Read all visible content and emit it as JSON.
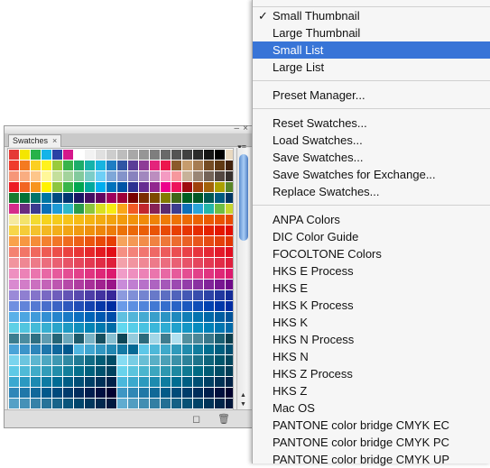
{
  "panel": {
    "tab_label": "Swatches",
    "tab_close": "×",
    "titlebar_minimize": "–",
    "titlebar_close": "×",
    "menu_glyph": "▾≡",
    "scroll_up": "▲",
    "scroll_down": "▼",
    "footer_new_icon": "◻",
    "footer_trash_icon": "🗑"
  },
  "menu": {
    "check_glyph": "✓",
    "items": [
      {
        "label": "",
        "checked": false
      },
      {
        "label": "Small Thumbnail",
        "checked": true
      },
      {
        "label": "Large Thumbnail",
        "checked": false
      },
      {
        "label": "Small List",
        "checked": false,
        "selected": true
      },
      {
        "label": "Large List",
        "checked": false
      },
      {
        "label": "Preset Manager...",
        "checked": false
      },
      {
        "label": "Reset Swatches...",
        "checked": false
      },
      {
        "label": "Load Swatches...",
        "checked": false
      },
      {
        "label": "Save Swatches...",
        "checked": false
      },
      {
        "label": "Save Swatches for Exchange...",
        "checked": false
      },
      {
        "label": "Replace Swatches...",
        "checked": false
      },
      {
        "label": "ANPA Colors",
        "checked": false
      },
      {
        "label": "DIC Color Guide",
        "checked": false
      },
      {
        "label": "FOCOLTONE Colors",
        "checked": false
      },
      {
        "label": "HKS E Process",
        "checked": false
      },
      {
        "label": "HKS E",
        "checked": false
      },
      {
        "label": "HKS K Process",
        "checked": false
      },
      {
        "label": "HKS K",
        "checked": false
      },
      {
        "label": "HKS N Process",
        "checked": false
      },
      {
        "label": "HKS N",
        "checked": false
      },
      {
        "label": "HKS Z Process",
        "checked": false
      },
      {
        "label": "HKS Z",
        "checked": false
      },
      {
        "label": "Mac OS",
        "checked": false
      },
      {
        "label": "PANTONE color bridge CMYK EC",
        "checked": false
      },
      {
        "label": "PANTONE color bridge CMYK PC",
        "checked": false
      },
      {
        "label": "PANTONE color bridge CMYK UP",
        "checked": false
      }
    ]
  },
  "swatch_rows": [
    [
      "#e53935",
      "#f4e600",
      "#27b24a",
      "#14b4e8",
      "#2a41a5",
      "#d5178b",
      "#ffffff",
      "#f2f2f2",
      "#e0e0e0",
      "#cdcdcd",
      "#bdbdbd",
      "#a8a8a8",
      "#969696",
      "#7e7e7e",
      "#696969",
      "#545454",
      "#414141",
      "#2b2b2b",
      "#151515",
      "#000000",
      "#e8d8c0"
    ],
    [
      "#ef3b2c",
      "#f47a21",
      "#fbcf22",
      "#fff21d",
      "#9acb3b",
      "#39b44a",
      "#1cad6a",
      "#16b3ab",
      "#17b4e0",
      "#1e7dc3",
      "#2f55a4",
      "#5a3d98",
      "#8e3c97",
      "#e4247b",
      "#ec174d",
      "#8b5a2b",
      "#c69c6d",
      "#a67c52",
      "#754c24",
      "#603913",
      "#41220d"
    ],
    [
      "#f69679",
      "#f9ad81",
      "#fdc68a",
      "#fff799",
      "#c4df9b",
      "#a3d39c",
      "#82ca9d",
      "#7bcdc8",
      "#6ecff6",
      "#7ea7d8",
      "#8493ca",
      "#8882be",
      "#a187be",
      "#bc8dbf",
      "#f49ac2",
      "#f6989d",
      "#c7b299",
      "#998675",
      "#736357",
      "#534741",
      "#37302d"
    ],
    [
      "#ed1c24",
      "#f26522",
      "#f7941d",
      "#fff200",
      "#8dc63f",
      "#39b54a",
      "#00a651",
      "#00a99d",
      "#00aeef",
      "#0072bc",
      "#0054a6",
      "#2e3192",
      "#662d91",
      "#92278f",
      "#ec008c",
      "#ed145b",
      "#9e0b0f",
      "#a0410d",
      "#a36209",
      "#aba000",
      "#598527"
    ],
    [
      "#197b30",
      "#007236",
      "#00746b",
      "#0076a3",
      "#004a80",
      "#003471",
      "#1b1464",
      "#440e62",
      "#630460",
      "#9e005d",
      "#9e0039",
      "#790000",
      "#7b2e00",
      "#7d4900",
      "#827b00",
      "#406618",
      "#005e20",
      "#005826",
      "#005952",
      "#005b7f",
      "#003663"
    ],
    [
      "#d62a8a",
      "#6a2c7e",
      "#3b3a8f",
      "#0b6fb6",
      "#1e9ad6",
      "#2fb7c9",
      "#2a9c4b",
      "#8cc63e",
      "#d9e021",
      "#f7ec13",
      "#f9a61a",
      "#f15a24",
      "#c1272d",
      "#862255",
      "#5b2c6f",
      "#3c3d8f",
      "#0f6fb7",
      "#2aa4d8",
      "#25b6a8",
      "#6fbe44",
      "#c6d52e"
    ],
    [
      "#f5e9a0",
      "#f3e36b",
      "#f3db31",
      "#f6d31d",
      "#f4cb1b",
      "#f6c31a",
      "#f5bb15",
      "#f4b312",
      "#f3ab10",
      "#f2a30d",
      "#f29b0c",
      "#f1930a",
      "#f08b09",
      "#ef8307",
      "#ee7b06",
      "#ed7305",
      "#ec6b04",
      "#eb6303",
      "#ea5b02",
      "#e95301",
      "#e84b00"
    ],
    [
      "#f7d64a",
      "#f5cc38",
      "#f4c22c",
      "#f3b822",
      "#f2ae1a",
      "#f1a414",
      "#f09a10",
      "#ef900d",
      "#ee860b",
      "#ed7c09",
      "#ec7208",
      "#eb6807",
      "#ea5e06",
      "#e95405",
      "#e84a04",
      "#e74003",
      "#e63602",
      "#e52c01",
      "#e42200",
      "#e31800",
      "#e20e00"
    ],
    [
      "#f9a24b",
      "#f79741",
      "#f58c38",
      "#f3812f",
      "#f17626",
      "#ef6b1e",
      "#ed6016",
      "#eb550f",
      "#e94a08",
      "#e73f02",
      "#f6a35c",
      "#f49853",
      "#f28d4a",
      "#f08241",
      "#ee7738",
      "#ec6c2f",
      "#ea6126",
      "#e8561d",
      "#e64b14",
      "#e4400b",
      "#e23502"
    ],
    [
      "#f48271",
      "#f27567",
      "#f0685d",
      "#ee5b53",
      "#ec4e49",
      "#ea413f",
      "#e83435",
      "#e6272b",
      "#e41a21",
      "#e20d17",
      "#f58f84",
      "#f3827a",
      "#f17570",
      "#ef6866",
      "#ed5b5c",
      "#eb4e52",
      "#e94148",
      "#e7343e",
      "#e52734",
      "#e31a2a",
      "#e10d20"
    ],
    [
      "#f1949e",
      "#ef8793",
      "#ed7a88",
      "#eb6d7d",
      "#e96072",
      "#e75367",
      "#e5465c",
      "#e33951",
      "#e12c46",
      "#df1f3b",
      "#f3a1ab",
      "#f194a0",
      "#ef8795",
      "#ed7a8a",
      "#eb6d7f",
      "#e96074",
      "#e75369",
      "#e5465e",
      "#e33953",
      "#e12c48",
      "#df1f3d"
    ],
    [
      "#ee8fc0",
      "#ec82b7",
      "#ea75ae",
      "#e868a5",
      "#e65b9c",
      "#e44e93",
      "#e2418a",
      "#e03481",
      "#de2778",
      "#dc1a6f",
      "#f09cc8",
      "#ee8fbf",
      "#ec82b6",
      "#ea75ad",
      "#e868a4",
      "#e65b9b",
      "#e44e92",
      "#e24189",
      "#e03480",
      "#de2777",
      "#dc1a6e"
    ],
    [
      "#d98ad0",
      "#d27dc8",
      "#cb70c0",
      "#c463b8",
      "#bd56b0",
      "#b649a8",
      "#af3ca0",
      "#a82f98",
      "#a12290",
      "#9a1588",
      "#c98bd9",
      "#c07ed1",
      "#b771c9",
      "#ae64c1",
      "#a557b9",
      "#9c4ab1",
      "#933da9",
      "#8a30a1",
      "#812399",
      "#781691",
      "#6f0989"
    ],
    [
      "#9a8ad8",
      "#8f7fd1",
      "#8474ca",
      "#7969c3",
      "#6e5ebc",
      "#6353b5",
      "#5848ae",
      "#4d3da7",
      "#4232a0",
      "#372799",
      "#8c9ade",
      "#808fd7",
      "#7484d0",
      "#6879c9",
      "#5c6ec2",
      "#5063bb",
      "#4458b4",
      "#384dad",
      "#2c42a6",
      "#20379f",
      "#142c98"
    ],
    [
      "#6f8fe0",
      "#6284d9",
      "#5579d2",
      "#486ecb",
      "#3b63c4",
      "#2e58bd",
      "#214db6",
      "#1442af",
      "#0737a8",
      "#002ca1",
      "#6a9ae8",
      "#5d8fe1",
      "#5084da",
      "#4379d3",
      "#366ecc",
      "#2963c5",
      "#1c58be",
      "#0f4db7",
      "#0242b0",
      "#0037a9",
      "#002ca2"
    ],
    [
      "#5ab0e8",
      "#4da5e1",
      "#409ada",
      "#338fd3",
      "#2684cc",
      "#1979c5",
      "#0c6ebe",
      "#0063b7",
      "#0058b0",
      "#004da9",
      "#5fc0e0",
      "#52b5d9",
      "#45aad2",
      "#389fcb",
      "#2b94c4",
      "#1e89bd",
      "#117eb6",
      "#0473af",
      "#0068a8",
      "#005da1",
      "#00529a"
    ],
    [
      "#5ed0e6",
      "#51c5df",
      "#44bad8",
      "#37afd1",
      "#2aa4ca",
      "#1d99c3",
      "#108ebc",
      "#0383b5",
      "#0078ae",
      "#006da7",
      "#62d8ef",
      "#55cde8",
      "#48c2e1",
      "#3bb7da",
      "#2eacd3",
      "#21a1cc",
      "#1496c5",
      "#078bbe",
      "#0080b7",
      "#0075b0",
      "#006aa9"
    ],
    [
      "#3c7d8f",
      "#4a8ca0",
      "#2f6f82",
      "#5e9bb0",
      "#256577",
      "#6aa7bb",
      "#1d5a6b",
      "#79b3c6",
      "#154f60",
      "#87bfd1",
      "#0e4656",
      "#95cbdc",
      "#2c6a7c",
      "#a3d6e6",
      "#3f7c8e",
      "#b1e0ef",
      "#52909f",
      "#4b8697",
      "#38778a",
      "#1a5f72",
      "#0a3e4d"
    ],
    [
      "#4aa3d8",
      "#3b94c9",
      "#2c85ba",
      "#1d76ab",
      "#0e679c",
      "#00588d",
      "#4fb5e0",
      "#40a6d1",
      "#3197c2",
      "#2288b3",
      "#1379a4",
      "#046a95",
      "#5cc7e8",
      "#4db8d9",
      "#3ea9ca",
      "#2f9abb",
      "#208bac",
      "#117c9d",
      "#026d8e",
      "#005e7f",
      "#004f70"
    ],
    [
      "#7ad4ee",
      "#6bc5df",
      "#5cb6d0",
      "#4da7c1",
      "#3e98b2",
      "#2f89a3",
      "#207a94",
      "#116b85",
      "#025c76",
      "#004d67",
      "#86dcf3",
      "#77cde4",
      "#68bed5",
      "#59afc6",
      "#4aa0b7",
      "#3b91a8",
      "#2c8299",
      "#1d738a",
      "#0e647b",
      "#00556c",
      "#00465d"
    ],
    [
      "#5ec9e6",
      "#4fbad7",
      "#40abc8",
      "#319cb9",
      "#228daa",
      "#137e9b",
      "#046f8c",
      "#00607d",
      "#00516e",
      "#00425f",
      "#69d3ec",
      "#5ac4dd",
      "#4bb5ce",
      "#3ca6bf",
      "#2d97b0",
      "#1e88a1",
      "#0f7992",
      "#006a83",
      "#005b74",
      "#004c65",
      "#003d56"
    ],
    [
      "#3aa8d0",
      "#2b99c1",
      "#1c8ab2",
      "#0d7ba3",
      "#006c94",
      "#005d85",
      "#004e76",
      "#003f67",
      "#003058",
      "#002149",
      "#4ab8dc",
      "#3ba9cd",
      "#2c9abe",
      "#1d8baf",
      "#0e7ca0",
      "#006d91",
      "#005e82",
      "#004f73",
      "#004064",
      "#003155",
      "#002246"
    ],
    [
      "#2f86b8",
      "#2077a9",
      "#11689a",
      "#02598b",
      "#004a7c",
      "#003b6d",
      "#002c5e",
      "#001d4f",
      "#000e40",
      "#000031",
      "#3e96c4",
      "#2f87b5",
      "#2078a6",
      "#116997",
      "#025a88",
      "#004b79",
      "#003c6a",
      "#002d5b",
      "#001e4c",
      "#000f3d",
      "#00002e"
    ],
    [
      "#54a0c6",
      "#4591b7",
      "#3682a8",
      "#277399",
      "#18648a",
      "#09557b",
      "#00466c",
      "#00375d",
      "#00284e",
      "#00193f",
      "#60acd0",
      "#519dc1",
      "#428eb2",
      "#337fa3",
      "#247094",
      "#156185",
      "#065276",
      "#004367",
      "#003458",
      "#002549",
      "#00163a"
    ]
  ]
}
